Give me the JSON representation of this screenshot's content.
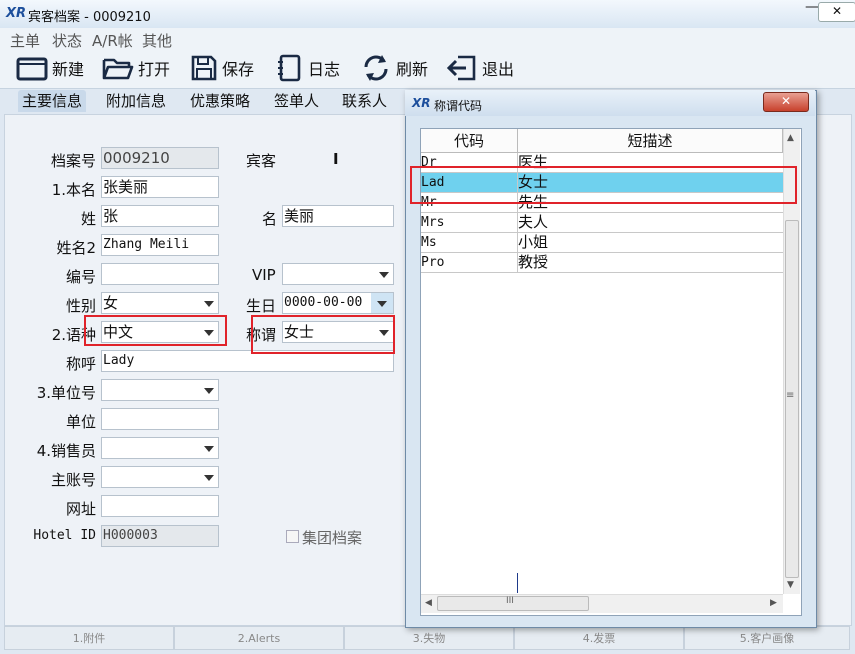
{
  "window": {
    "logo": "XR",
    "title": "宾客档案 - 0009210",
    "minimize": "—",
    "close": "✕"
  },
  "menu": [
    "主单",
    "状态",
    "A/R帐",
    "其他"
  ],
  "toolbar": [
    {
      "label": "新建",
      "icon": "new-icon"
    },
    {
      "label": "打开",
      "icon": "open-folder-icon"
    },
    {
      "label": "保存",
      "icon": "save-icon"
    },
    {
      "label": "日志",
      "icon": "log-icon"
    },
    {
      "label": "刷新",
      "icon": "refresh-icon"
    },
    {
      "label": "退出",
      "icon": "exit-icon"
    }
  ],
  "tabs": [
    "主要信息",
    "附加信息",
    "优惠策略",
    "签单人",
    "联系人"
  ],
  "form": {
    "profile_no_label": "档案号",
    "profile_no": "0009210",
    "guest_label": "宾客",
    "guest_type": "I",
    "name_label": "1.本名",
    "name": "张美丽",
    "surname_label": "姓",
    "surname": "张",
    "given_label": "名",
    "given": "美丽",
    "name2_label": "姓名2",
    "name2": "Zhang Meili",
    "code_label": "编号",
    "code": "",
    "vip_label": "VIP",
    "vip": "",
    "gender_label": "性别",
    "gender": "女",
    "birthday_label": "生日",
    "birthday": "0000-00-00",
    "language_label": "2.语种",
    "language": "中文",
    "title_label": "称谓",
    "title": "女士",
    "salutation_label": "称呼",
    "salutation": "Lady",
    "company_no_label": "3.单位号",
    "company_no": "",
    "company_label": "单位",
    "company": "",
    "sales_label": "4.销售员",
    "sales": "",
    "master_label": "主账号",
    "master": "",
    "website_label": "网址",
    "website": "",
    "hotel_id_label": "Hotel ID",
    "hotel_id": "H000003",
    "group_label": "集团档案"
  },
  "bottom_tabs": [
    "1.附件",
    "2.Alerts",
    "3.失物",
    "4.发票",
    "5.客户画像"
  ],
  "dialog": {
    "logo": "XR",
    "title": "称谓代码",
    "close": "✕",
    "columns": [
      "代码",
      "短描述"
    ],
    "rows": [
      {
        "code": "Dr",
        "desc": "医生"
      },
      {
        "code": "Lad",
        "desc": "女士",
        "selected": true
      },
      {
        "code": "Mr",
        "desc": "先生"
      },
      {
        "code": "Mrs",
        "desc": "夫人"
      },
      {
        "code": "Ms",
        "desc": "小姐"
      },
      {
        "code": "Pro",
        "desc": "教授"
      }
    ],
    "scroll_grip": "≡",
    "hscroll_grip": "III"
  },
  "colors": {
    "selected_row": "#6fd1ee",
    "highlight": "#e0232a"
  }
}
